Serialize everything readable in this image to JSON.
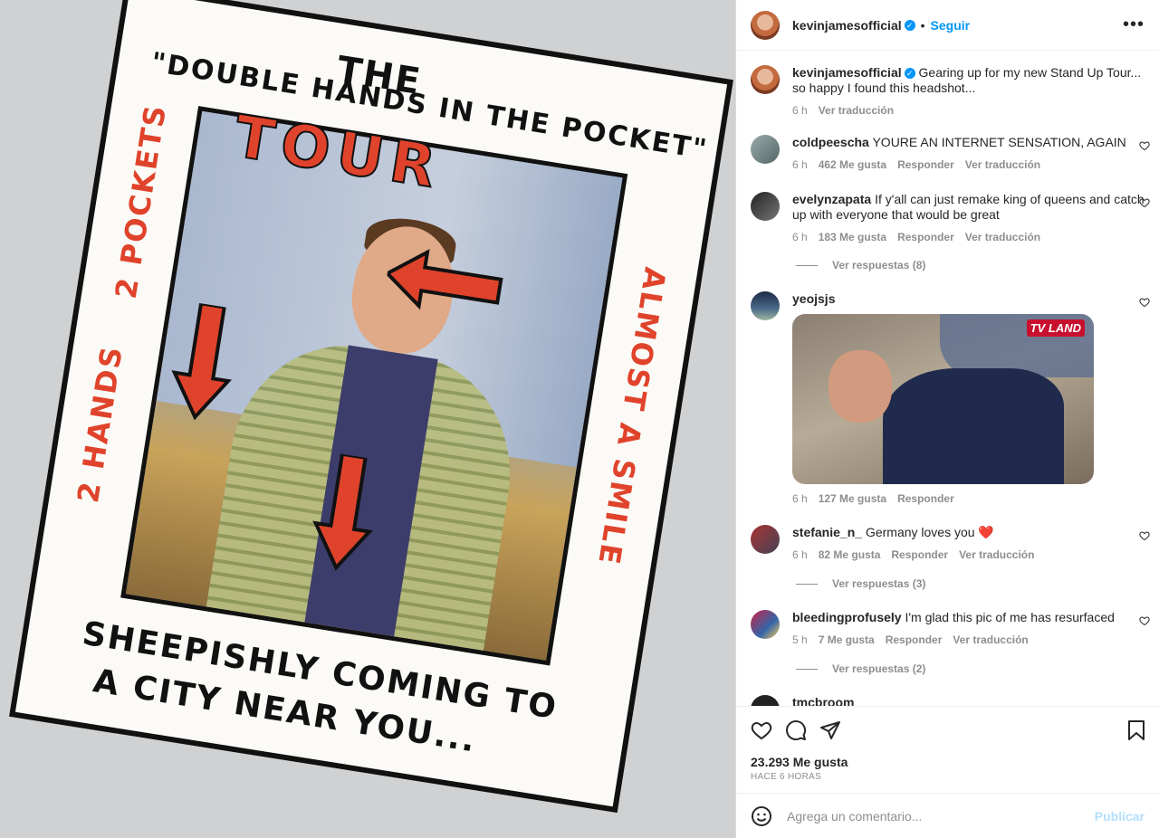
{
  "post": {
    "username": "kevinjamesofficial",
    "follow_label": "Seguir",
    "more_icon": "•••",
    "verified_icon": "✓",
    "caption": "Gearing up for my new Stand Up Tour... so happy I found this headshot...",
    "caption_time": "6 h",
    "caption_translate": "Ver traducción"
  },
  "poster_text": {
    "title_top": "THE",
    "title_line": "\"DOUBLE HANDS IN THE POCKET\"",
    "tour": "TOUR",
    "left_side_1": "2 POCKETS",
    "left_side_2": "2 HANDS",
    "right_side": "ALMOST A SMILE",
    "bottom_1": "SHEEPISHLY COMING TO",
    "bottom_2": "A CITY NEAR YOU..."
  },
  "comments": [
    {
      "user": "coldpeescha",
      "text": "YOURE AN INTERNET SENSATION, AGAIN",
      "time": "6 h",
      "likes": "462 Me gusta",
      "reply": "Responder",
      "translate": "Ver traducción"
    },
    {
      "user": "evelynzapata",
      "text": "If y'all can just remake king of queens and catch up with everyone that would be great",
      "time": "6 h",
      "likes": "183 Me gusta",
      "reply": "Responder",
      "translate": "Ver traducción",
      "replies": "Ver respuestas (8)"
    },
    {
      "user": "yeojsjs",
      "text": "",
      "time": "6 h",
      "likes": "127 Me gusta",
      "reply": "Responder",
      "gif_badge": "TV LAND"
    },
    {
      "user": "stefanie_n_",
      "text": "Germany loves you ❤️",
      "time": "6 h",
      "likes": "82 Me gusta",
      "reply": "Responder",
      "translate": "Ver traducción",
      "replies": "Ver respuestas (3)"
    },
    {
      "user": "bleedingprofusely",
      "text": "I'm glad this pic of me has resurfaced",
      "time": "5 h",
      "likes": "7 Me gusta",
      "reply": "Responder",
      "translate": "Ver traducción",
      "replies": "Ver respuestas (2)"
    },
    {
      "user": "tmcbroom",
      "text": ""
    }
  ],
  "footer": {
    "likes": "23.293 Me gusta",
    "time": "HACE 6 HORAS",
    "comment_placeholder": "Agrega un comentario...",
    "post_label": "Publicar"
  },
  "icons": [
    "heart-icon",
    "comment-icon",
    "share-icon",
    "bookmark-icon",
    "emoji-icon",
    "more-icon"
  ]
}
